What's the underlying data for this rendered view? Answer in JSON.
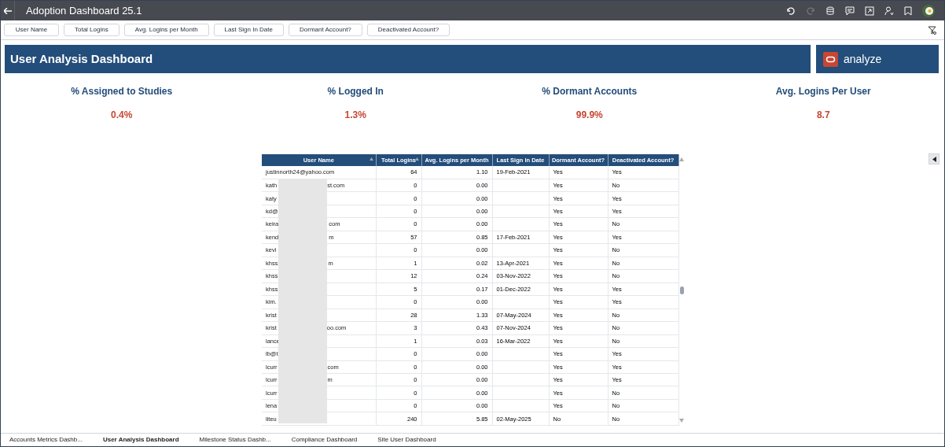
{
  "window": {
    "title": "Adoption Dashboard 25.1"
  },
  "filters": [
    "User Name",
    "Total Logins",
    "Avg. Logins per Month",
    "Last Sign In Date",
    "Dormant Account?",
    "Deactivated Account?"
  ],
  "banner": {
    "title": "User Analysis Dashboard",
    "logo_text": "analyze"
  },
  "kpis": [
    {
      "label": "% Assigned to Studies",
      "value": "0.4%"
    },
    {
      "label": "% Logged In",
      "value": "1.3%"
    },
    {
      "label": "% Dormant Accounts",
      "value": "99.9%"
    },
    {
      "label": "Avg. Logins Per User",
      "value": "8.7"
    }
  ],
  "table": {
    "columns": [
      {
        "label": "User Name",
        "sorted": true
      },
      {
        "label": "Total Logins",
        "sorted": true
      },
      {
        "label": "Avg. Logins per Month",
        "sorted": false
      },
      {
        "label": "Last Sign In Date",
        "sorted": false
      },
      {
        "label": "Dormant Account?",
        "sorted": false
      },
      {
        "label": "Deactivated Account?",
        "sorted": false
      }
    ],
    "rows": [
      {
        "user_prefix": "justinnorth24@yahoo.com",
        "user_suffix": "",
        "logins": "64",
        "avg": "1.10",
        "last": "19-Feb-2021",
        "dormant": "Yes",
        "deactivated": "Yes"
      },
      {
        "user_prefix": "kath",
        "user_suffix": "st.com",
        "logins": "0",
        "avg": "0.00",
        "last": "",
        "dormant": "Yes",
        "deactivated": "No"
      },
      {
        "user_prefix": "katy",
        "user_suffix": "",
        "logins": "0",
        "avg": "0.00",
        "last": "",
        "dormant": "Yes",
        "deactivated": "Yes"
      },
      {
        "user_prefix": "kd@",
        "user_suffix": "",
        "logins": "0",
        "avg": "0.00",
        "last": "",
        "dormant": "Yes",
        "deactivated": "Yes"
      },
      {
        "user_prefix": "keira",
        "user_suffix": "com",
        "logins": "0",
        "avg": "0.00",
        "last": "",
        "dormant": "Yes",
        "deactivated": "No"
      },
      {
        "user_prefix": "kend",
        "user_suffix": "m",
        "logins": "57",
        "avg": "0.85",
        "last": "17-Feb-2021",
        "dormant": "Yes",
        "deactivated": "Yes"
      },
      {
        "user_prefix": "kevi",
        "user_suffix": "",
        "logins": "0",
        "avg": "0.00",
        "last": "",
        "dormant": "Yes",
        "deactivated": "No"
      },
      {
        "user_prefix": "khss",
        "user_suffix": "m",
        "logins": "1",
        "avg": "0.02",
        "last": "13-Apr-2021",
        "dormant": "Yes",
        "deactivated": "No"
      },
      {
        "user_prefix": "khss",
        "user_suffix": "",
        "logins": "12",
        "avg": "0.24",
        "last": "03-Nov-2022",
        "dormant": "Yes",
        "deactivated": "No"
      },
      {
        "user_prefix": "khss",
        "user_suffix": "",
        "logins": "5",
        "avg": "0.17",
        "last": "01-Dec-2022",
        "dormant": "Yes",
        "deactivated": "Yes"
      },
      {
        "user_prefix": "kim.",
        "user_suffix": "",
        "logins": "0",
        "avg": "0.00",
        "last": "",
        "dormant": "Yes",
        "deactivated": "Yes"
      },
      {
        "user_prefix": "krist",
        "user_suffix": "",
        "logins": "28",
        "avg": "1.33",
        "last": "07-May-2024",
        "dormant": "Yes",
        "deactivated": "No"
      },
      {
        "user_prefix": "krist",
        "user_suffix": "oo.com",
        "logins": "3",
        "avg": "0.43",
        "last": "07-Nov-2024",
        "dormant": "Yes",
        "deactivated": "No"
      },
      {
        "user_prefix": "lance",
        "user_suffix": "",
        "logins": "1",
        "avg": "0.03",
        "last": "16-Mar-2022",
        "dormant": "Yes",
        "deactivated": "No"
      },
      {
        "user_prefix": "lb@t",
        "user_suffix": "",
        "logins": "0",
        "avg": "0.00",
        "last": "",
        "dormant": "Yes",
        "deactivated": "Yes"
      },
      {
        "user_prefix": "lcurr",
        "user_suffix": "com",
        "logins": "0",
        "avg": "0.00",
        "last": "",
        "dormant": "Yes",
        "deactivated": "Yes"
      },
      {
        "user_prefix": "lcurr",
        "user_suffix": "m",
        "logins": "0",
        "avg": "0.00",
        "last": "",
        "dormant": "Yes",
        "deactivated": "Yes"
      },
      {
        "user_prefix": "lcurr",
        "user_suffix": "",
        "logins": "0",
        "avg": "0.00",
        "last": "",
        "dormant": "Yes",
        "deactivated": "No"
      },
      {
        "user_prefix": "lena",
        "user_suffix": "",
        "logins": "0",
        "avg": "0.00",
        "last": "",
        "dormant": "Yes",
        "deactivated": "No"
      },
      {
        "user_prefix": "liteu",
        "user_suffix": "",
        "logins": "240",
        "avg": "5.85",
        "last": "02-May-2025",
        "dormant": "No",
        "deactivated": "No"
      }
    ]
  },
  "bottom_tabs": [
    {
      "label": "Accounts Metrics Dashb...",
      "selected": false
    },
    {
      "label": "User Analysis Dashboard",
      "selected": true
    },
    {
      "label": "Milestone Status Dashb...",
      "selected": false
    },
    {
      "label": "Compliance Dashboard",
      "selected": false
    },
    {
      "label": "Site User Dashboard",
      "selected": false
    }
  ]
}
